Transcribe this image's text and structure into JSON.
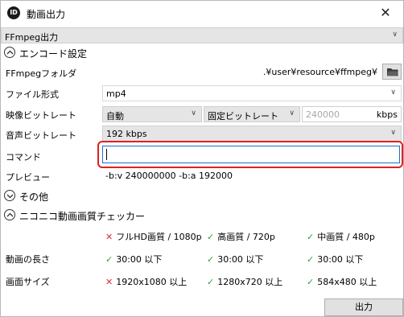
{
  "window": {
    "title": "動画出力",
    "close_glyph": "✕",
    "app_icon_text": "ID"
  },
  "mode_select": {
    "value": "FFmpeg出力"
  },
  "encode_section": {
    "title": "エンコード設定"
  },
  "rows": {
    "ffmpeg_folder": {
      "label": "FFmpegフォルダ",
      "path": ".¥user¥resource¥ffmpeg¥"
    },
    "file_format": {
      "label": "ファイル形式",
      "value": "mp4"
    },
    "video_bitrate": {
      "label": "映像ビットレート",
      "mode": "自動",
      "kind": "固定ビットレート",
      "value": "240000",
      "unit": "kbps"
    },
    "audio_bitrate": {
      "label": "音声ビットレート",
      "value": "192 kbps"
    },
    "command": {
      "label": "コマンド",
      "value": ""
    },
    "preview": {
      "label": "プレビュー",
      "value": "-b:v 240000000 -b:a 192000"
    }
  },
  "other_section": {
    "title": "その他"
  },
  "nico_section": {
    "title": "ニコニコ動画画質チェッカー",
    "quality": [
      {
        "mark": "✕",
        "ok": false,
        "text": "フルHD画質 / 1080p"
      },
      {
        "mark": "✓",
        "ok": true,
        "text": "高画質 / 720p"
      },
      {
        "mark": "✓",
        "ok": true,
        "text": "中画質 / 480p"
      }
    ],
    "length": {
      "label": "動画の長さ",
      "items": [
        {
          "mark": "✓",
          "ok": true,
          "text": "30:00 以下"
        },
        {
          "mark": "✓",
          "ok": true,
          "text": "30:00 以下"
        },
        {
          "mark": "✓",
          "ok": true,
          "text": "30:00 以下"
        }
      ]
    },
    "size": {
      "label": "画面サイズ",
      "items": [
        {
          "mark": "✕",
          "ok": false,
          "text": "1920x1080 以上"
        },
        {
          "mark": "✓",
          "ok": true,
          "text": "1280x720 以上"
        },
        {
          "mark": "✓",
          "ok": true,
          "text": "584x480 以上"
        }
      ]
    }
  },
  "footer": {
    "output_label": "出力"
  },
  "colors": {
    "highlight": "#e02020",
    "ok": "#2f9e44",
    "ng": "#d93030"
  }
}
